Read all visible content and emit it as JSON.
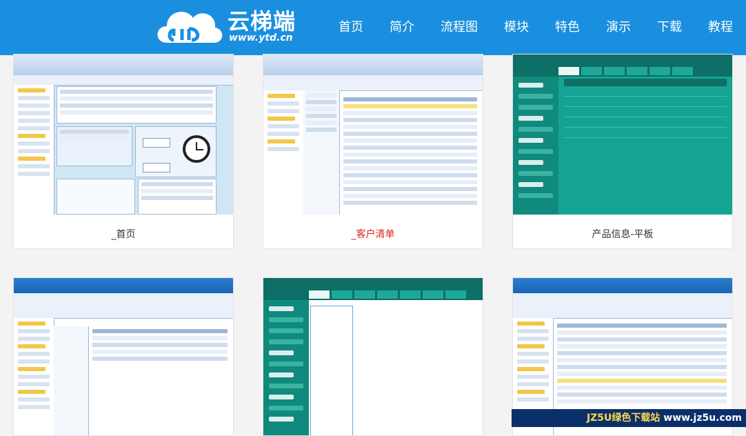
{
  "header": {
    "brand": "云梯端",
    "domain": "www.ytd.cn",
    "nav": [
      "首页",
      "简介",
      "流程图",
      "模块",
      "特色",
      "演示",
      "下载",
      "教程"
    ]
  },
  "cards": [
    {
      "caption": "_首页"
    },
    {
      "caption": "_客户清单"
    },
    {
      "caption": "产品信息-平板"
    }
  ],
  "watermark": {
    "brand": "JZ5U绿色下载站",
    "url": "www.jz5u.com"
  },
  "colors": {
    "header": "#1a8fe0",
    "caption_active": "#d9261c",
    "teal": "#0f8a7d"
  }
}
